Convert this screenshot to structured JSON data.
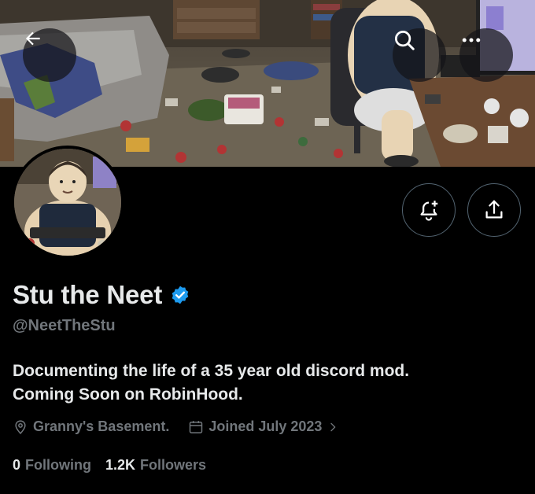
{
  "profile": {
    "display_name": "Stu the Neet",
    "handle": "@NeetTheStu",
    "verified": true,
    "bio_line_1": "Documenting the life of a 35 year old discord mod.",
    "bio_line_2": "Coming Soon on RobinHood.",
    "location": "Granny's Basement.",
    "joined": "Joined July 2023",
    "following_count": "0",
    "following_label": "Following",
    "followers_count": "1.2K",
    "followers_label": "Followers"
  },
  "icons": {
    "back": "arrow-left-icon",
    "search": "search-icon",
    "more": "more-horizontal-icon",
    "notify": "bell-plus-icon",
    "share": "share-icon",
    "verified": "verified-badge-icon",
    "location": "location-pin-icon",
    "calendar": "calendar-icon",
    "chevron": "chevron-right-icon"
  },
  "colors": {
    "background": "#000000",
    "text_primary": "#e7e9ea",
    "text_secondary": "#71767b",
    "verified_blue": "#1d9bf0",
    "button_border": "#536471"
  }
}
